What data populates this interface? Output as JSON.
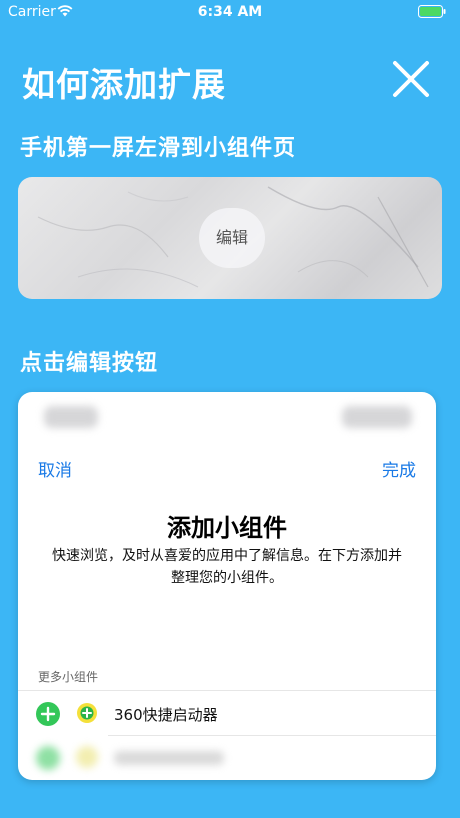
{
  "status_bar": {
    "carrier": "Carrier",
    "time": "6:34 AM",
    "battery_color": "#4cd964"
  },
  "header": {
    "title": "如何添加扩展"
  },
  "steps": {
    "step1_title": "手机第一屏左滑到小组件页",
    "edit_label": "编辑",
    "step2_title": "点击编辑按钮"
  },
  "panel": {
    "cancel_label": "取消",
    "done_label": "完成",
    "title": "添加小组件",
    "description": "快速浏览，及时从喜爱的应用中了解信息。在下方添加并整理您的小组件。",
    "section_label": "更多小组件",
    "items": [
      {
        "label": "360快捷启动器",
        "icon": "360-launcher-icon"
      }
    ]
  },
  "colors": {
    "background": "#3cb6f5",
    "link": "#1a7ae6",
    "add": "#33c759"
  }
}
